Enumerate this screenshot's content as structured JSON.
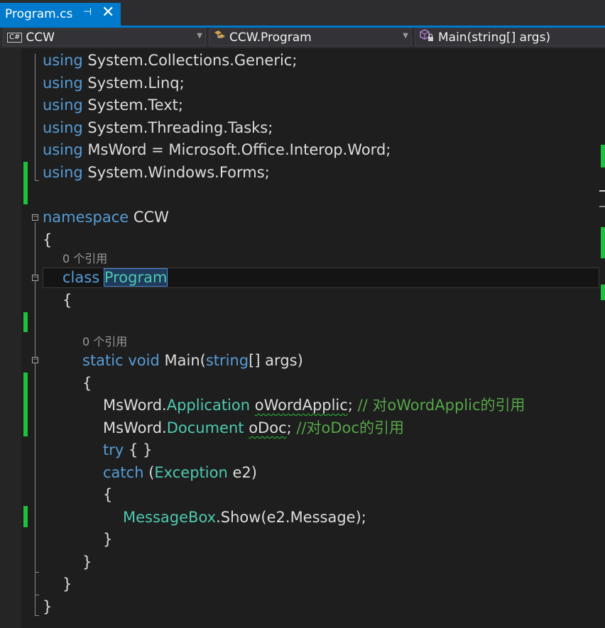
{
  "tab": {
    "title": "Program.cs",
    "pin_icon": "pin-icon",
    "close_icon": "close-icon",
    "pin_glyph": "⊣",
    "close_glyph": "✕"
  },
  "navbar": {
    "project": {
      "icon": "csharp-project-icon",
      "icon_glyph": "C#",
      "label": "CCW"
    },
    "type": {
      "icon": "class-icon",
      "label": "CCW.Program"
    },
    "member": {
      "icon": "method-icon",
      "label": "Main(string[] args)"
    }
  },
  "code": {
    "kw_using": "using",
    "using1": "System.Collections.Generic;",
    "using2": "System.Linq;",
    "using3": "System.Text;",
    "using4": "System.Threading.Tasks;",
    "using5_alias": "MsWord = Microsoft.Office.Interop.Word;",
    "using6": "System.Windows.Forms;",
    "kw_namespace": "namespace",
    "ns_name": "CCW",
    "brace_open": "{",
    "brace_close": "}",
    "lens_class": "0 个引用",
    "kw_class": "class",
    "class_name": "Program",
    "lens_method": "0 个引用",
    "kw_static": "static",
    "kw_void": "void",
    "method_name": "Main(",
    "kw_string": "string",
    "method_params": "[] args)",
    "l1_prefix": "MsWord.",
    "l1_type": "Application",
    "l1_var": "oWordApplic",
    "l1_semi": ";",
    "l1_comment": "// 对oWordApplic的引用",
    "l2_prefix": "MsWord.",
    "l2_type": "Document",
    "l2_var": "oDoc",
    "l2_semi": ";",
    "l2_comment": "//对oDoc的引用",
    "kw_try": "try",
    "try_body": "{ }",
    "kw_catch": "catch",
    "catch_open": "(",
    "catch_type": "Exception",
    "catch_var": "e2)",
    "msg_type": "MessageBox",
    "msg_call": ".Show(e2.Message);"
  },
  "colors": {
    "keyword": "#569cd6",
    "type": "#4ec9b0",
    "comment": "#57a64a",
    "accent": "#007acc",
    "change_mark": "#1ec03d"
  }
}
